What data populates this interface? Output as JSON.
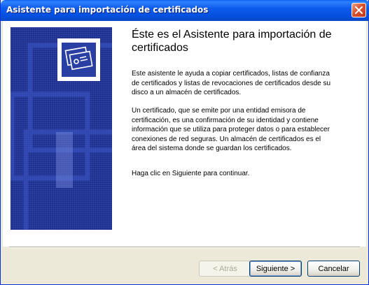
{
  "window": {
    "title": "Asistente para importación de certificados",
    "accent_color": "#0A5FF5",
    "close_icon": "close-icon"
  },
  "side_panel": {
    "icon": "certificate-icon",
    "background_color": "#1A2B8C"
  },
  "main": {
    "heading": "Éste es el Asistente para importación de certificados",
    "paragraphs": [
      "Este asistente le ayuda a copiar certificados, listas de confianza de certificados y listas de revocaciones de certificados desde su disco a un almacén de certificados.",
      "Un certificado, que se emite por una entidad emisora de certificación, es una confirmación de su identidad y contiene información que se utiliza para proteger datos o para establecer conexiones de red seguras. Un almacén de certificados es el área del sistema donde se guardan los certificados.",
      "Haga clic en Siguiente para continuar."
    ]
  },
  "buttons": {
    "back_label": "< Atrás",
    "next_label": "Siguiente >",
    "cancel_label": "Cancelar"
  }
}
